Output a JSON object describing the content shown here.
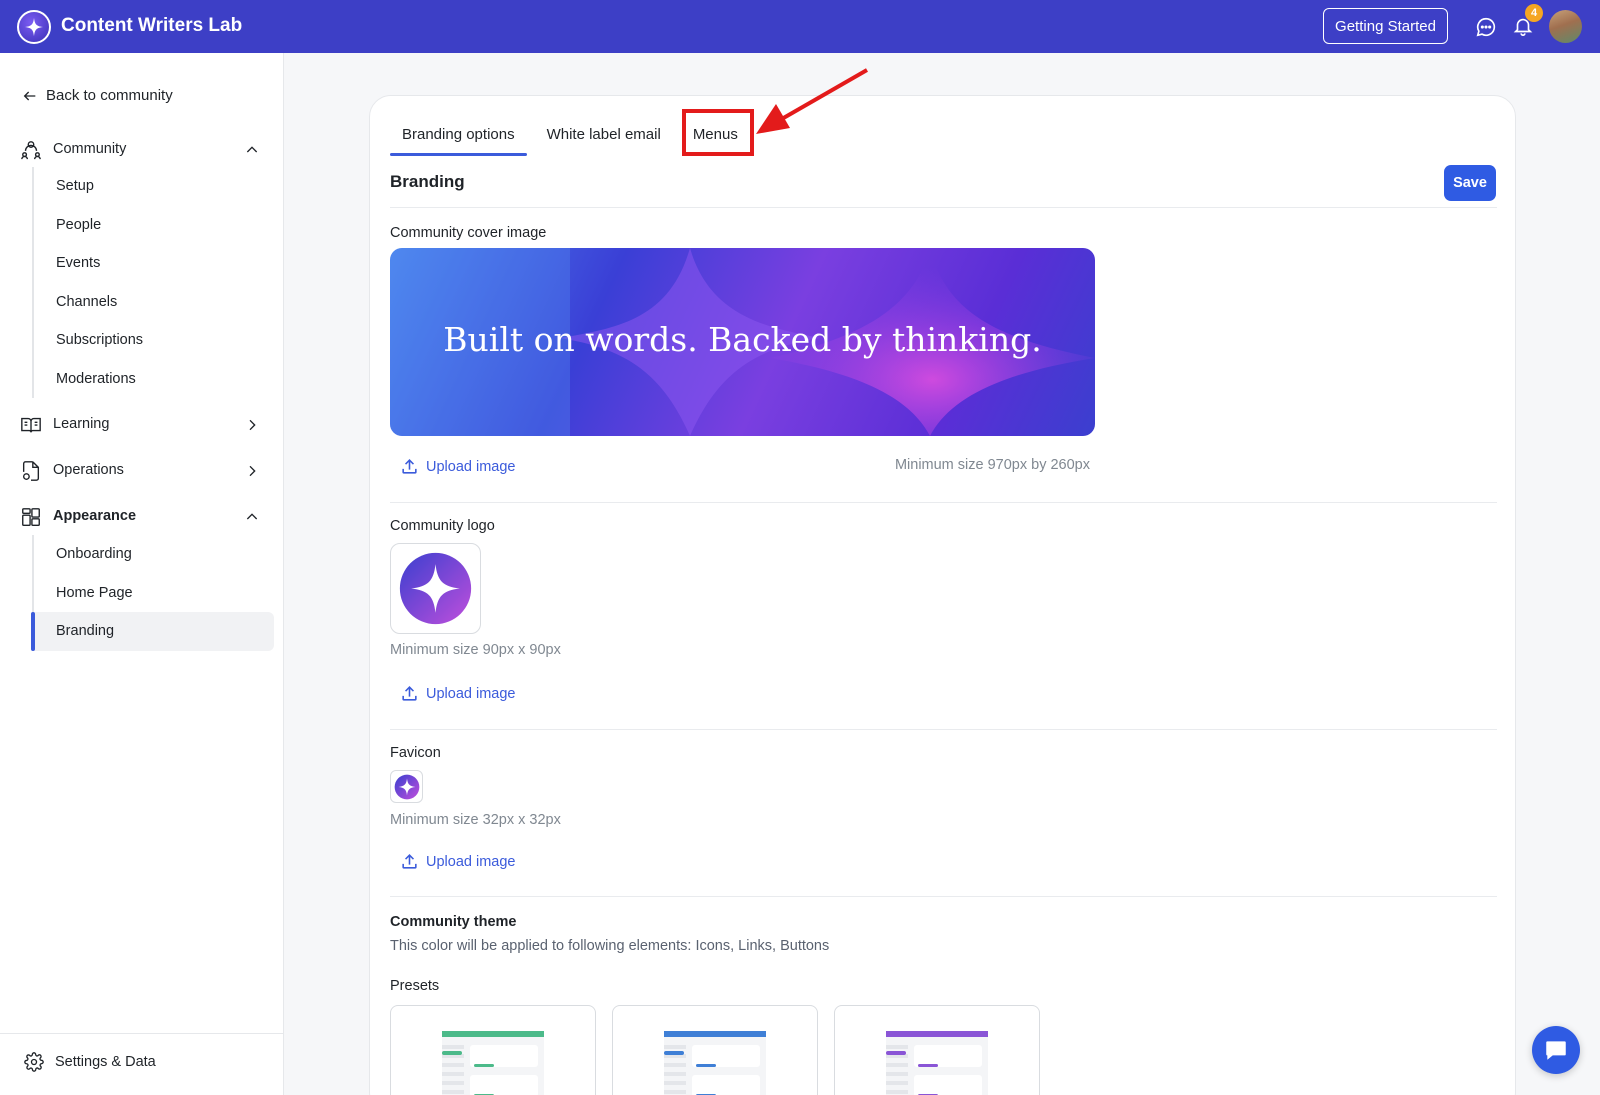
{
  "header": {
    "app_title": "Content Writers Lab",
    "getting_started_label": "Getting Started",
    "notification_count": "4"
  },
  "sidebar": {
    "back_label": "Back to community",
    "groups": [
      {
        "label": "Community",
        "expanded": true,
        "items": [
          "Setup",
          "People",
          "Events",
          "Channels",
          "Subscriptions",
          "Moderations"
        ]
      },
      {
        "label": "Learning",
        "expanded": false
      },
      {
        "label": "Operations",
        "expanded": false
      },
      {
        "label": "Appearance",
        "expanded": true,
        "items": [
          "Onboarding",
          "Home Page",
          "Branding"
        ],
        "active_item": "Branding"
      }
    ],
    "settings_label": "Settings & Data"
  },
  "tabs": [
    {
      "label": "Branding options",
      "active": true
    },
    {
      "label": "White label email",
      "active": false
    },
    {
      "label": "Menus",
      "active": false,
      "highlighted": true
    }
  ],
  "branding": {
    "title": "Branding",
    "save_label": "Save",
    "cover": {
      "label": "Community cover image",
      "image_text": "Built on words. Backed by thinking.",
      "upload_label": "Upload image",
      "min_size": "Minimum size 970px by 260px"
    },
    "logo": {
      "label": "Community logo",
      "min_size": "Minimum size 90px x 90px",
      "upload_label": "Upload image"
    },
    "favicon": {
      "label": "Favicon",
      "min_size": "Minimum size 32px x 32px",
      "upload_label": "Upload image"
    },
    "theme": {
      "title": "Community theme",
      "description": "This color will be applied to following elements: Icons, Links, Buttons",
      "presets_label": "Presets",
      "preset_colors": [
        "#4cba8a",
        "#3f7fd6",
        "#8a55d6"
      ]
    }
  },
  "colors": {
    "header_bg": "#3d3fc6",
    "accent": "#2f5be3",
    "annotation_red": "#e31b1b"
  }
}
